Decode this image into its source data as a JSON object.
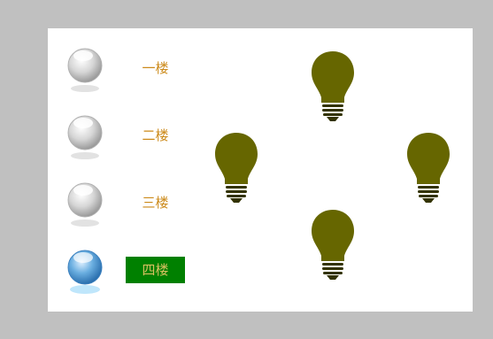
{
  "floors": [
    {
      "label": "一楼",
      "state": "off"
    },
    {
      "label": "二楼",
      "state": "off"
    },
    {
      "label": "三楼",
      "state": "off"
    },
    {
      "label": "四楼",
      "state": "on"
    }
  ],
  "colors": {
    "page_background": "#c0c0c0",
    "panel_background": "#ffffff",
    "label_text": "#cc8a1a",
    "active_label_background": "#008000",
    "active_label_text": "#d8c060",
    "bulb": "#666600",
    "ball_off": "#c8c8c8",
    "ball_on": "#5fa3d9"
  },
  "bulbs": [
    {
      "name": "top",
      "icon": "light-bulb-icon"
    },
    {
      "name": "left",
      "icon": "light-bulb-icon"
    },
    {
      "name": "right",
      "icon": "light-bulb-icon"
    },
    {
      "name": "bottom",
      "icon": "light-bulb-icon"
    }
  ]
}
